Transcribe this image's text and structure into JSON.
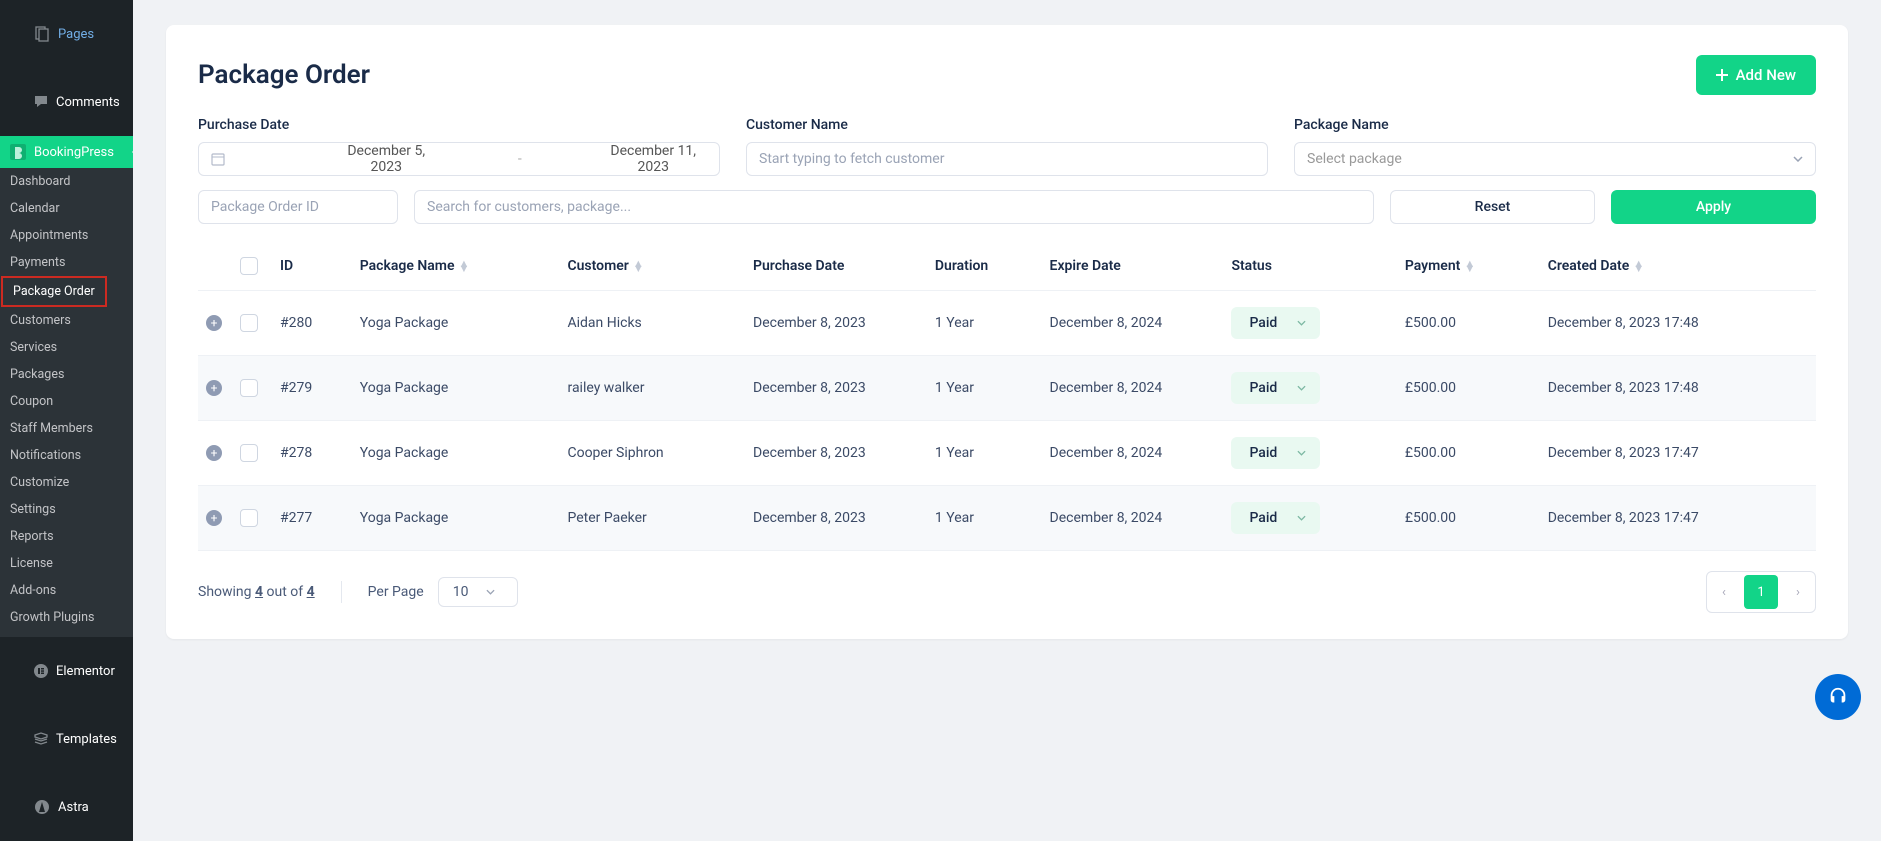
{
  "sidebar": {
    "top": [
      {
        "icon": "pages",
        "label": "Pages"
      },
      {
        "icon": "comments",
        "label": "Comments"
      }
    ],
    "bp": {
      "label": "BookingPress"
    },
    "subs": [
      "Dashboard",
      "Calendar",
      "Appointments",
      "Payments",
      "Package Order",
      "Customers",
      "Services",
      "Packages",
      "Coupon",
      "Staff Members",
      "Notifications",
      "Customize",
      "Settings",
      "Reports",
      "License",
      "Add-ons",
      "Growth Plugins"
    ],
    "bottom": [
      {
        "icon": "elementor",
        "label": "Elementor"
      },
      {
        "icon": "templates",
        "label": "Templates"
      },
      {
        "icon": "astra",
        "label": "Astra"
      }
    ]
  },
  "page": {
    "title": "Package Order",
    "add_btn": "Add New",
    "labels": {
      "purchase": "Purchase Date",
      "customer": "Customer Name",
      "package": "Package Name"
    },
    "date_from": "December 5, 2023",
    "date_to": "December 11, 2023",
    "ph_customer": "Start typing to fetch customer",
    "ph_package": "Select package",
    "ph_order_id": "Package Order ID",
    "ph_search": "Search for customers, package...",
    "btn_reset": "Reset",
    "btn_apply": "Apply"
  },
  "table": {
    "headers": {
      "id": "ID",
      "package": "Package Name",
      "customer": "Customer",
      "purchase": "Purchase Date",
      "duration": "Duration",
      "expire": "Expire Date",
      "status": "Status",
      "payment": "Payment",
      "created": "Created Date"
    },
    "rows": [
      {
        "id": "#280",
        "package": "Yoga Package",
        "customer": "Aidan Hicks",
        "purchase": "December 8, 2023",
        "duration": "1 Year",
        "expire": "December 8, 2024",
        "status": "Paid",
        "payment": "£500.00",
        "created": "December 8, 2023 17:48"
      },
      {
        "id": "#279",
        "package": "Yoga Package",
        "customer": "railey walker",
        "purchase": "December 8, 2023",
        "duration": "1 Year",
        "expire": "December 8, 2024",
        "status": "Paid",
        "payment": "£500.00",
        "created": "December 8, 2023 17:48"
      },
      {
        "id": "#278",
        "package": "Yoga Package",
        "customer": "Cooper Siphron",
        "purchase": "December 8, 2023",
        "duration": "1 Year",
        "expire": "December 8, 2024",
        "status": "Paid",
        "payment": "£500.00",
        "created": "December 8, 2023 17:47"
      },
      {
        "id": "#277",
        "package": "Yoga Package",
        "customer": "Peter Paeker",
        "purchase": "December 8, 2023",
        "duration": "1 Year",
        "expire": "December 8, 2024",
        "status": "Paid",
        "payment": "£500.00",
        "created": "December 8, 2023 17:47"
      }
    ]
  },
  "footer": {
    "showing_pre": "Showing ",
    "count": "4",
    "showing_mid": " out of ",
    "total": "4",
    "perpage_label": "Per Page",
    "perpage_val": "10",
    "page_current": "1"
  }
}
